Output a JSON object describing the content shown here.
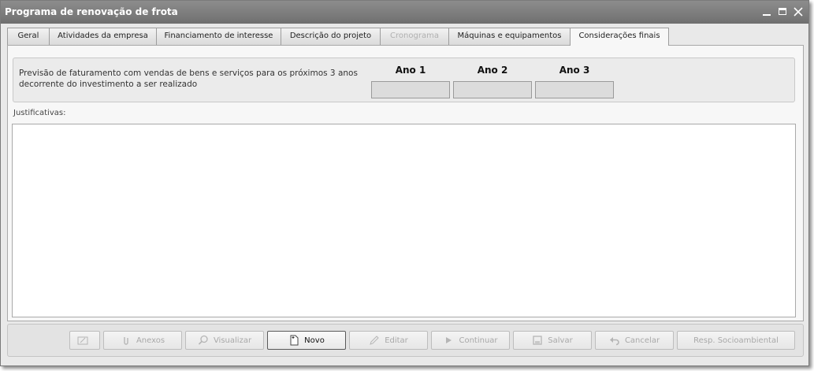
{
  "window": {
    "title": "Programa de renovação de frota"
  },
  "tabs": [
    {
      "label": "Geral",
      "state": "normal"
    },
    {
      "label": "Atividades da empresa",
      "state": "normal"
    },
    {
      "label": "Financiamento de interesse",
      "state": "normal"
    },
    {
      "label": "Descrição do projeto",
      "state": "normal"
    },
    {
      "label": "Cronograma",
      "state": "disabled"
    },
    {
      "label": "Máquinas e equipamentos",
      "state": "normal"
    },
    {
      "label": "Considerações finais",
      "state": "active"
    }
  ],
  "forecast": {
    "text": "Previsão de faturamento com vendas de bens e serviços para os próximos 3 anos decorrente do investimento a ser realizado",
    "years": [
      {
        "label": "Ano 1",
        "value": ""
      },
      {
        "label": "Ano 2",
        "value": ""
      },
      {
        "label": "Ano 3",
        "value": ""
      }
    ]
  },
  "justification": {
    "label": "Justificativas:",
    "value": ""
  },
  "toolbar": {
    "buttons": [
      {
        "label": "",
        "icon": "sign-icon",
        "enabled": false
      },
      {
        "label": "Anexos",
        "icon": "paperclip-icon",
        "enabled": false
      },
      {
        "label": "Visualizar",
        "icon": "magnifier-icon",
        "enabled": false
      },
      {
        "label": "Novo",
        "icon": "new-document-icon",
        "enabled": true
      },
      {
        "label": "Editar",
        "icon": "pencil-icon",
        "enabled": false
      },
      {
        "label": "Continuar",
        "icon": "play-icon",
        "enabled": false
      },
      {
        "label": "Salvar",
        "icon": "disk-icon",
        "enabled": false
      },
      {
        "label": "Cancelar",
        "icon": "undo-icon",
        "enabled": false
      },
      {
        "label": "Resp. Socioambiental",
        "icon": "",
        "enabled": false
      }
    ]
  },
  "colors": {
    "titlebar": "#7c7c7c",
    "panel": "#f7f7f7",
    "disabled_text": "#a8a8a8"
  }
}
